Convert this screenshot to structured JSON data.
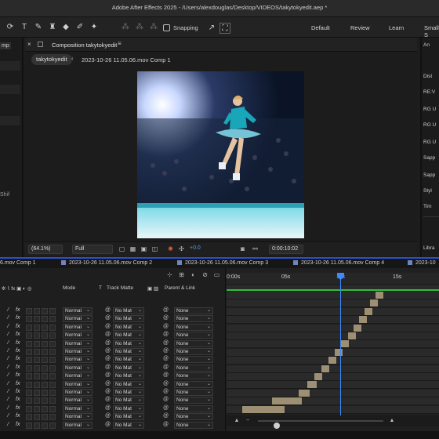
{
  "window": {
    "title": "Adobe After Effects 2025 - /Users/alexdouglas/Desktop/VIDEOS/takytokyedit.aep *"
  },
  "toolbar": {
    "snapping_label": "Snapping",
    "workspaces": [
      "Default",
      "Review",
      "Learn",
      "Small S"
    ]
  },
  "left_panel": {
    "tab_label": "mp",
    "partial_text": "Shif"
  },
  "composition_panel": {
    "title": "Composition takytokyedit",
    "breadcrumb_active": "takytokyedit",
    "breadcrumb_next": "2023-10-26 11.05.06.mov Comp 1",
    "zoom": "(64.1%)",
    "resolution": "Full",
    "exposure": "+0.0",
    "timecode": "0:00:10:02"
  },
  "right_panel": {
    "items": [
      "An",
      "Dist",
      "RE:V",
      "RG U",
      "RG U",
      "RG U",
      "Sapp",
      "Sapp",
      "Styl",
      "Tim",
      "Libra"
    ]
  },
  "timeline": {
    "tabs": [
      "6.mov Comp 1",
      "2023-10-26 11.05.06.mov Comp 2",
      "2023-10-26 11.05.06.mov Comp 3",
      "2023-10-26 11.05.06.mov Comp 4",
      "2023-10"
    ],
    "columns": {
      "mode": "Mode",
      "t": "T",
      "track_matte": "Track Matte",
      "parent_link": "Parent & Link"
    },
    "ruler_labels": [
      "0:00s",
      "05s",
      "10s",
      "15s"
    ],
    "layer_mode": "Normal",
    "layer_matte": "No Mat",
    "layer_parent": "None",
    "layer_count": 15
  },
  "colors": {
    "playhead": "#3d8bff",
    "work_area": "#2fbf3a",
    "clip": "#9c8f73",
    "tab_highlight": "#2b4fd0"
  }
}
